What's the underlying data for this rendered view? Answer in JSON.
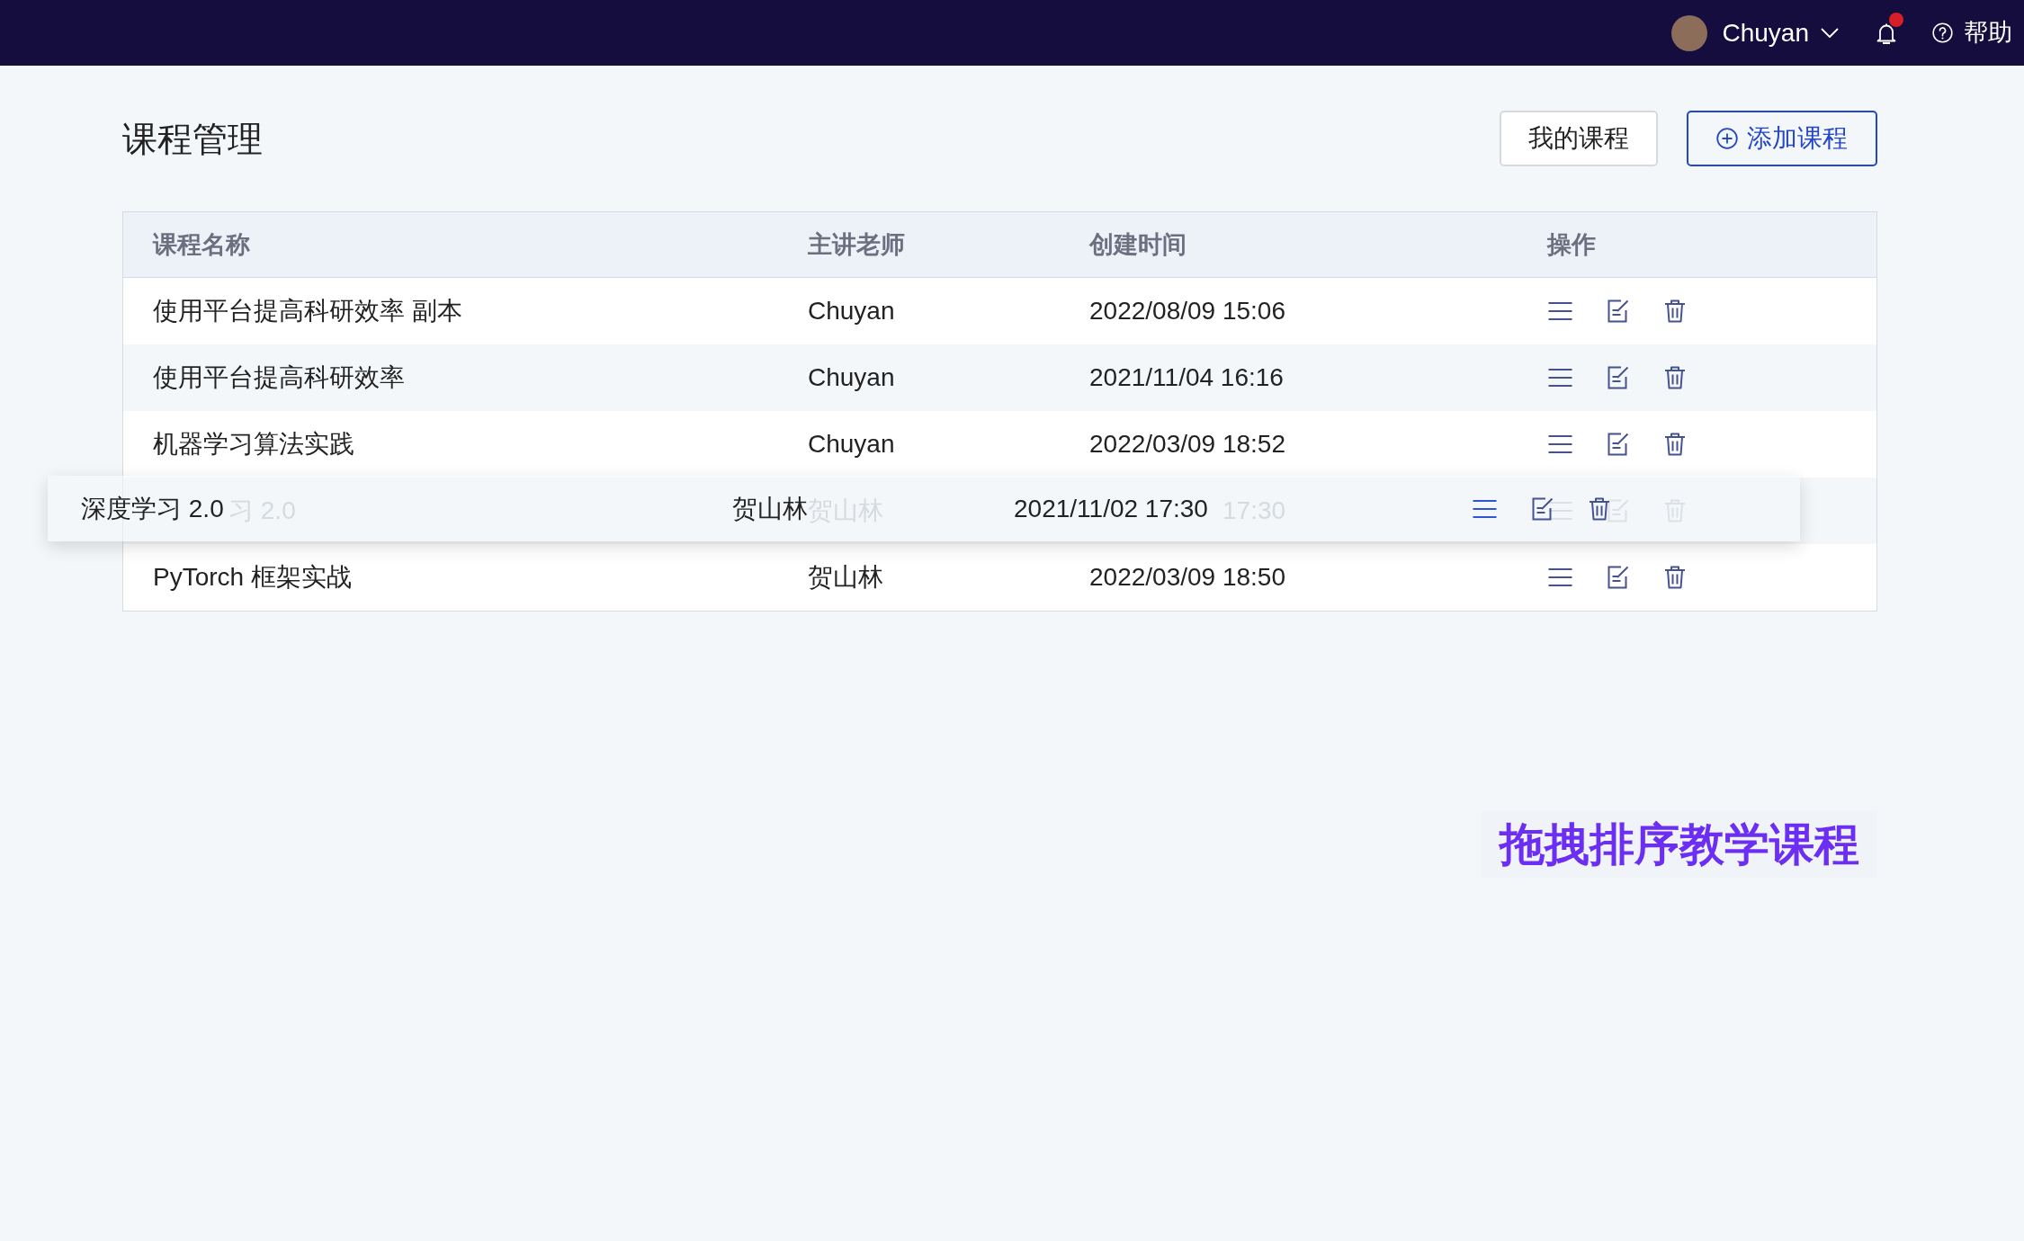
{
  "top_bar": {
    "user_name": "Chuyan",
    "has_unread": true,
    "help_label": "帮助"
  },
  "header": {
    "title": "课程管理",
    "buttons": [
      {
        "label": "我的课程",
        "kind": "secondary"
      },
      {
        "label": "添加课程",
        "kind": "primary"
      }
    ]
  },
  "table": {
    "columns": [
      "课程名称",
      "主讲老师",
      "创建时间",
      "操作"
    ],
    "rows": [
      {
        "kind": "normal",
        "name": "使用平台提高科研效率 副本",
        "teacher": "Chuyan",
        "created": "2022/08/09 15:06"
      },
      {
        "kind": "normal",
        "name": "使用平台提高科研效率",
        "teacher": "Chuyan",
        "created": "2021/11/04 16:16"
      },
      {
        "kind": "normal",
        "name": "机器学习算法实践",
        "teacher": "Chuyan",
        "created": "2022/03/09 18:52"
      },
      {
        "kind": "placeholder",
        "name": "习 2.0",
        "teacher": "贺山林",
        "created": "17:30"
      },
      {
        "kind": "normal",
        "name": "PyTorch 框架实战",
        "teacher": "贺山林",
        "created": "2022/03/09 18:50"
      }
    ],
    "drag_preview": {
      "name": "深度学习 2.0",
      "teacher": "贺山林",
      "created": "2021/11/02 17:30",
      "handle_highlighted": true
    }
  },
  "caption": "拖拽排序教学课程"
}
